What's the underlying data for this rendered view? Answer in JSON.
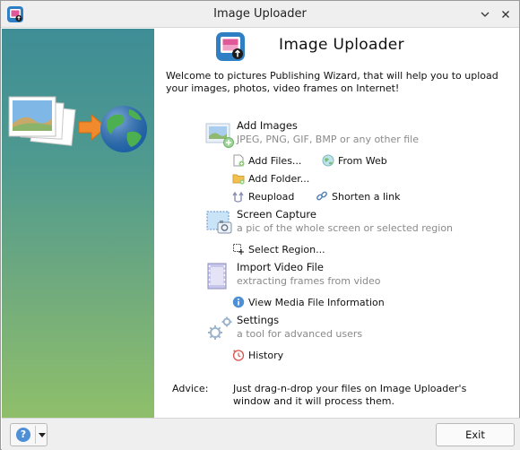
{
  "window": {
    "title": "Image Uploader"
  },
  "header": {
    "title": "Image Uploader",
    "welcome": "Welcome to pictures Publishing Wizard, that will help you to upload your images, photos, video frames on Internet!"
  },
  "sections": {
    "add_images": {
      "title": "Add Images",
      "desc": "JPEG, PNG, GIF, BMP or any other file",
      "links": {
        "add_files": "Add Files...",
        "from_web": "From Web",
        "add_folder": "Add Folder...",
        "reupload": "Reupload",
        "shorten": "Shorten a link"
      }
    },
    "screen_capture": {
      "title": "Screen Capture",
      "desc": "a pic of the whole screen or selected region",
      "links": {
        "select_region": "Select Region..."
      }
    },
    "import_video": {
      "title": "Import Video File",
      "desc": "extracting frames from video",
      "links": {
        "media_info": "View Media File Information"
      }
    },
    "settings": {
      "title": "Settings",
      "desc": "a tool for advanced users",
      "links": {
        "history": "History"
      }
    }
  },
  "advice": {
    "label": "Advice:",
    "text": "Just drag-n-drop your files on Image Uploader's window and it will process them."
  },
  "footer": {
    "help_glyph": "?",
    "exit_label": "Exit"
  },
  "colors": {
    "sidebar_top": "#3f8d96",
    "sidebar_bottom": "#8fbf6a",
    "link_blue": "#4e8fd6",
    "desc_gray": "#8a8a8a"
  }
}
